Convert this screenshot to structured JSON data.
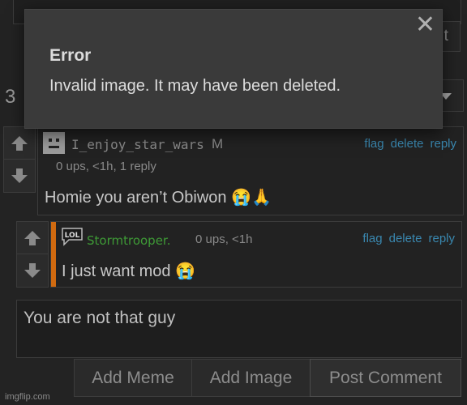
{
  "background": {
    "count": "3",
    "partial_button": "t"
  },
  "modal": {
    "title": "Error",
    "message": "Invalid image. It may have been deleted.",
    "close": "✕"
  },
  "comments": [
    {
      "username": "I_enjoy_star_wars",
      "badge": "M",
      "meta": "0 ups, <1h, 1 reply",
      "text": "Homie you aren’t Obiwon 😭🙏",
      "actions": {
        "flag": "flag",
        "delete": "delete",
        "reply": "reply"
      }
    },
    {
      "username": "Stormtrooper.",
      "meta": "0 ups, <1h",
      "text": "I just want mod 😭",
      "avatar_text": "LOL",
      "actions": {
        "flag": "flag",
        "delete": "delete",
        "reply": "reply"
      }
    }
  ],
  "compose": {
    "value": "You are not that guy"
  },
  "buttons": {
    "add_meme": "Add Meme",
    "add_image": "Add Image",
    "post_comment": "Post Comment"
  },
  "watermark": "imgflip.com",
  "colors": {
    "link": "#3a88b0",
    "username_green": "#3e9a36",
    "reply_bar": "#d06a10"
  }
}
